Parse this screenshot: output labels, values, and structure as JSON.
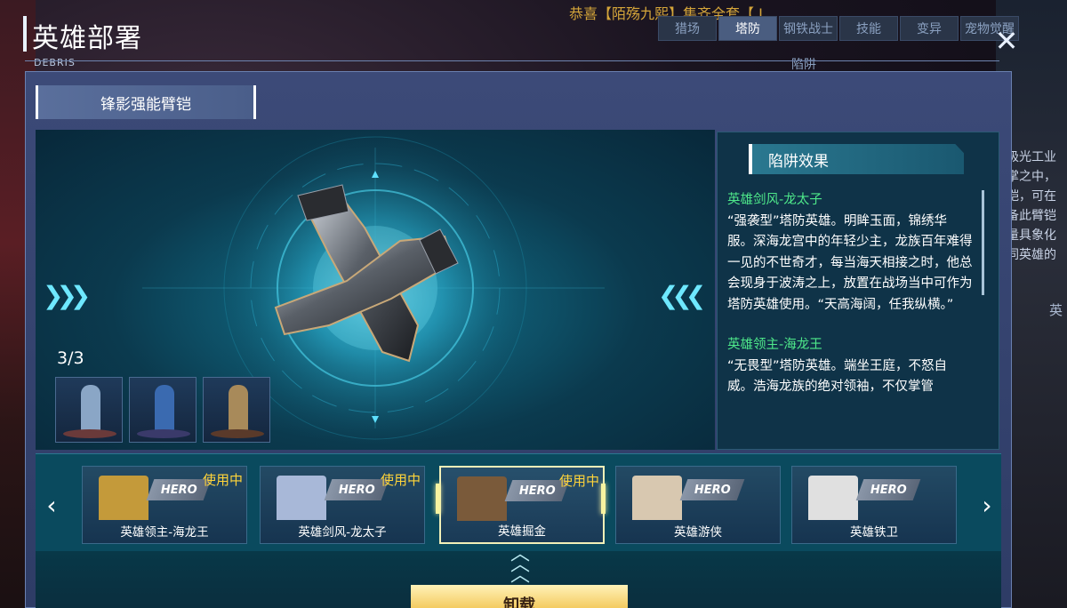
{
  "background": {
    "banner": "恭喜【陌殇九熙】集齐全套【 L",
    "tabs": [
      "猎场",
      "塔防",
      "钢铁战士",
      "技能",
      "变异",
      "宠物觉醒"
    ],
    "active_tab": "塔防",
    "sub_label": "陷阱",
    "side_text": [
      "极光工业",
      "掌之中，",
      "铠，可在",
      "备此臂铠",
      "量具象化",
      "同英雄的"
    ],
    "side_label": "英"
  },
  "header": {
    "title": "英雄部署",
    "subtitle": "DEBRIS",
    "close_icon": "close-icon"
  },
  "item": {
    "name": "锋影强能臂铠",
    "counter": "3/3",
    "thumbnails": [
      {
        "figure_color": "#8aa6c6",
        "base_color": "#6a3a3a"
      },
      {
        "figure_color": "#3a6ab0",
        "base_color": "#3a3a6a"
      },
      {
        "figure_color": "#a88a5a",
        "base_color": "#5a3a2a"
      }
    ]
  },
  "effect": {
    "title": "陷阱效果",
    "entries": [
      {
        "hero": "英雄剑风-龙太子",
        "text": "“强袭型”塔防英雄。明眸玉面，锦绣华服。深海龙宫中的年轻少主，龙族百年难得一见的不世奇才，每当海天相接之时，他总会现身于波涛之上，放置在战场当中可作为塔防英雄使用。“天高海阔，任我纵横。”"
      },
      {
        "hero": "英雄领主-海龙王",
        "text": "“无畏型”塔防英雄。端坐王庭，不怒自威。浩海龙族的绝对领袖，不仅掌管"
      }
    ]
  },
  "heroes": {
    "tag": "HERO",
    "in_use_label": "使用中",
    "items": [
      {
        "name": "英雄领主-海龙王",
        "in_use": true,
        "portrait_color": "#c49a3a"
      },
      {
        "name": "英雄剑风-龙太子",
        "in_use": true,
        "portrait_color": "#a8b8d8"
      },
      {
        "name": "英雄掘金",
        "in_use": true,
        "portrait_color": "#7a5a3a"
      },
      {
        "name": "英雄游侠",
        "in_use": false,
        "portrait_color": "#d8c8b0"
      },
      {
        "name": "英雄铁卫",
        "in_use": false,
        "portrait_color": "#e0e0e0"
      }
    ],
    "selected_index": 2
  },
  "actions": {
    "unload_label": "卸载"
  },
  "colors": {
    "accent_cyan": "#6ee8ff",
    "hero_name_green": "#4ee88a",
    "in_use_yellow": "#ffd43a",
    "panel_blue": "#3c4a78"
  }
}
